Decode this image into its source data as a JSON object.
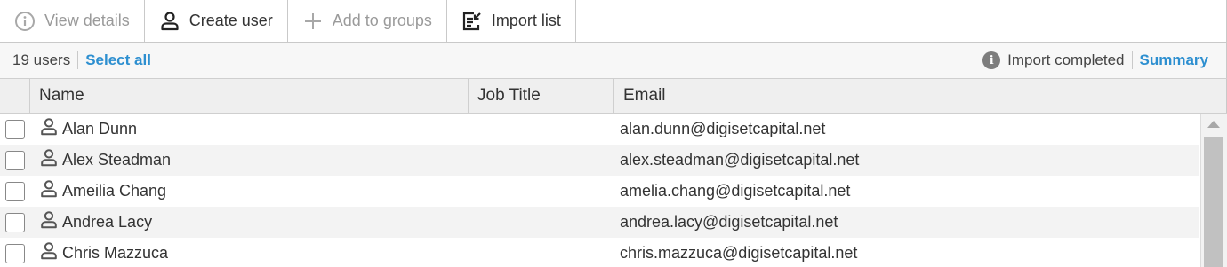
{
  "toolbar": {
    "view_details": "View details",
    "create_user": "Create user",
    "add_to_groups": "Add to groups",
    "import_list": "Import list"
  },
  "status": {
    "user_count": "19 users",
    "select_all": "Select all",
    "import_status": "Import completed",
    "summary": "Summary"
  },
  "table": {
    "columns": [
      "Name",
      "Job Title",
      "Email"
    ],
    "rows": [
      {
        "name": "Alan Dunn",
        "job": "",
        "email": "alan.dunn@digisetcapital.net"
      },
      {
        "name": "Alex Steadman",
        "job": "",
        "email": "alex.steadman@digisetcapital.net"
      },
      {
        "name": "Ameilia Chang",
        "job": "",
        "email": "amelia.chang@digisetcapital.net"
      },
      {
        "name": "Andrea Lacy",
        "job": "",
        "email": "andrea.lacy@digisetcapital.net"
      },
      {
        "name": "Chris Mazzuca",
        "job": "",
        "email": "chris.mazzuca@digisetcapital.net"
      }
    ]
  },
  "colors": {
    "accent": "#2d8fd0",
    "disabled_text": "#9a9a9a"
  }
}
